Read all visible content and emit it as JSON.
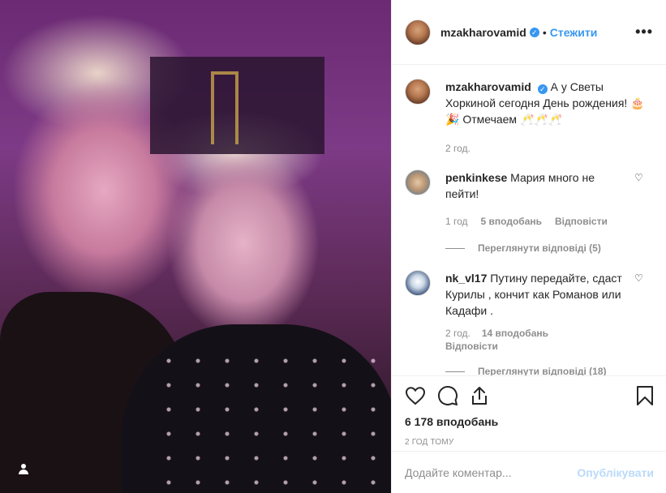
{
  "post": {
    "username": "mzakharovamid",
    "separator": "•",
    "follow_label": "Стежити",
    "more_label": "•••",
    "caption": "А у Светы Хоркиной сегодня День рождения! 🎂🎉 Отмечаем 🥂🥂🥂",
    "caption_time": "2 год."
  },
  "comments": [
    {
      "username": "penkinkese",
      "text": "Мария много не пейти!",
      "time": "1 год",
      "likes": "5 вподобань",
      "reply_label": "Відповісти",
      "view_replies": "Переглянути відповіді (5)"
    },
    {
      "username": "nk_vl17",
      "text": "Путину передайте, сдаст Курилы , кончит как Романов или Кадафи .",
      "time": "2 год.",
      "likes": "14 вподобань",
      "reply_label": "Відповісти",
      "view_replies": "Переглянути відповіді (18)"
    }
  ],
  "actions": {
    "like_count": "6 178 вподобань",
    "posted": "2 год тому"
  },
  "composer": {
    "placeholder": "Додайте коментар...",
    "publish_label": "Опублікувати"
  },
  "icons": {
    "like": "heart-icon",
    "comment": "comment-icon",
    "share": "share-icon",
    "save": "bookmark-icon",
    "tag": "user-tag-icon",
    "verified": "verified-badge-icon"
  },
  "colors": {
    "accent": "#3897f0",
    "muted": "#8e8e8e",
    "text": "#262626"
  }
}
